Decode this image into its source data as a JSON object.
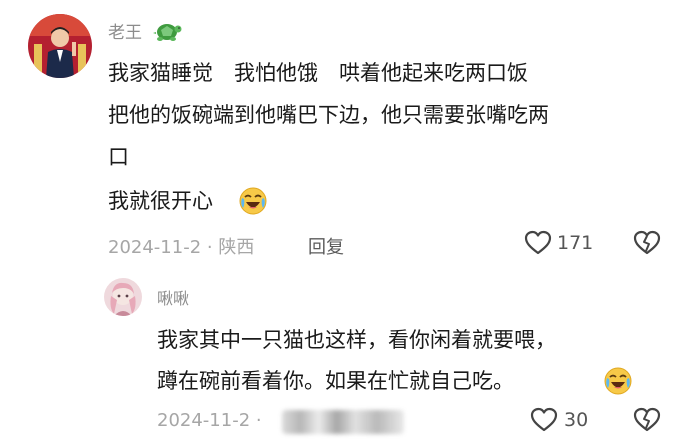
{
  "comment": {
    "username": "老王",
    "badge_icon": "turtle-icon",
    "lines": [
      "我家猫睡觉　我怕他饿　哄着他起来吃两口饭",
      "把他的饭碗端到他嘴巴下边，他只需要张嘴吃两",
      "口",
      "我就很开心"
    ],
    "emoji": "crying-laughing-emoji",
    "date_location": "2024-11-2 · 陕西",
    "reply_label": "回复",
    "like_count": "171"
  },
  "reply": {
    "username": "啾啾",
    "lines": [
      "我家其中一只猫也这样，看你闲着就要喂，",
      "蹲在碗前看着你。如果在忙就自己吃。"
    ],
    "emoji": "crying-laughing-emoji",
    "date": "2024-11-2 ·",
    "like_count": "30"
  },
  "colors": {
    "text": "#1a1a1a",
    "meta": "#a6a6a6",
    "username": "#8c8c8c",
    "turtle": "#4caf50",
    "emoji_face": "#f7c948"
  }
}
